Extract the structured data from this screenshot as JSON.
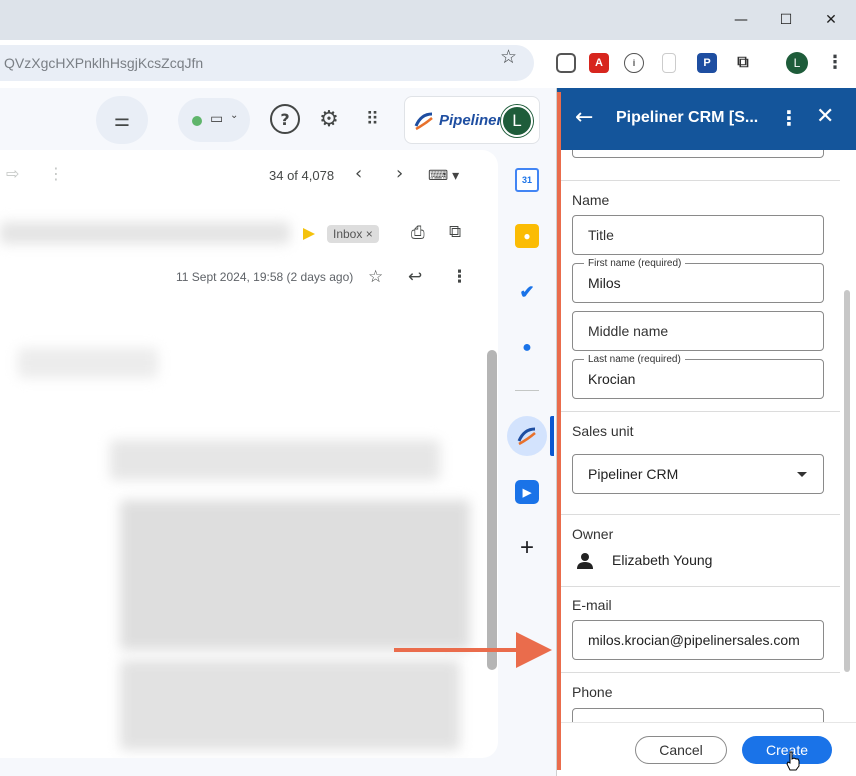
{
  "browser": {
    "url": "QVzXgcHXPnklhHsgjKcsZcqJfn",
    "profile_initial": "L",
    "window_controls": {
      "minimize": "—",
      "maximize": "☐",
      "close": "✕"
    }
  },
  "gmail": {
    "pipeliner_chip_label": "Pipeliner",
    "account_initial": "L",
    "counter": "34 of 4,078",
    "inbox_label": "Inbox",
    "inbox_remove": "×",
    "email_date": "11 Sept 2024, 19:58 (2 days ago)"
  },
  "rail": {
    "calendar_day": "31"
  },
  "crm": {
    "title": "Pipeliner CRM [S...",
    "sections": {
      "name_label": "Name",
      "sales_unit_label": "Sales unit",
      "owner_label": "Owner",
      "email_label": "E-mail",
      "phone_label": "Phone"
    },
    "fields": {
      "title_placeholder": "Title",
      "first_name_label": "First name (required)",
      "first_name_value": "Milos",
      "middle_name_placeholder": "Middle name",
      "last_name_label": "Last name (required)",
      "last_name_value": "Krocian",
      "sales_unit_value": "Pipeliner CRM",
      "owner_name": "Elizabeth Young",
      "email_value": "milos.krocian@pipelinersales.com"
    },
    "buttons": {
      "cancel": "Cancel",
      "create": "Create"
    }
  },
  "colors": {
    "crm_header": "#14559b",
    "create_button": "#1a73e8",
    "annotation": "#ea6c4c"
  }
}
